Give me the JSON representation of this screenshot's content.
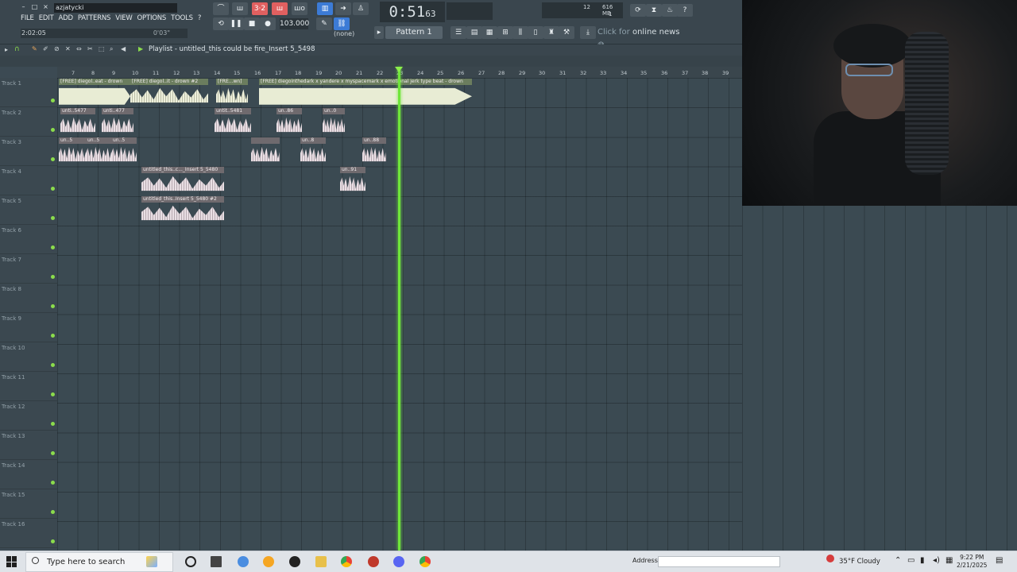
{
  "app": {
    "title": "azjatycki",
    "menu": [
      "FILE",
      "EDIT",
      "ADD",
      "PATTERNS",
      "VIEW",
      "OPTIONS",
      "TOOLS",
      "?"
    ],
    "song_time": "2:02:05",
    "hint_time": "0'03\"",
    "bpm": "103.000",
    "time_main": "0:51",
    "time_frac": "63",
    "cpu_num": "12",
    "ram": "616 MB",
    "cpu_num2": "1",
    "pattern": "Pattern 1",
    "none_label": "(none)",
    "news_prefix": "Click for",
    "news_bold": "online news",
    "playlist_title": "Playlist - untitled_this could be fire_Insert 5_5498"
  },
  "ruler": [
    "7",
    "8",
    "9",
    "10",
    "11",
    "12",
    "13",
    "14",
    "15",
    "16",
    "17",
    "18",
    "19",
    "20",
    "21",
    "22",
    "23",
    "24",
    "25",
    "26",
    "27",
    "28",
    "29",
    "30",
    "31",
    "32",
    "33",
    "34",
    "35",
    "36",
    "37",
    "38",
    "39"
  ],
  "tracks": [
    "Track 1",
    "Track 2",
    "Track 3",
    "Track 4",
    "Track 5",
    "Track 6",
    "Track 7",
    "Track 8",
    "Track 9",
    "Track 10",
    "Track 11",
    "Track 12",
    "Track 13",
    "Track 14",
    "Track 15",
    "Track 16"
  ],
  "clips": {
    "t1a": "[FREE] diegol..eat - drown",
    "t1b": "[FREE] diegol..it - drown #2",
    "t1c": "[FRE...wn]",
    "t1d": "[FREE] diegointhedark x yandere x myspacemark x emotional jerk type beat - drown",
    "t2a": "unti..5477",
    "t2b": "unti..477",
    "t2c": "untit..5481",
    "t2d": "un..86",
    "t2e": "un..0",
    "t3a": "un..5",
    "t3b": "un..5",
    "t3c": "un..5",
    "t3d": "",
    "t3e": "un..8",
    "t3f": "un..88",
    "t4a": "untitled_this..c..._Insert 5_5480",
    "t4b": "un..91",
    "t5a": "untitled_this..Insert 5_5480 #2"
  },
  "taskbar": {
    "search_placeholder": "Type here to search",
    "address_label": "Address",
    "weather": "35°F  Cloudy",
    "time": "9:22 PM",
    "date": "2/21/2025"
  }
}
